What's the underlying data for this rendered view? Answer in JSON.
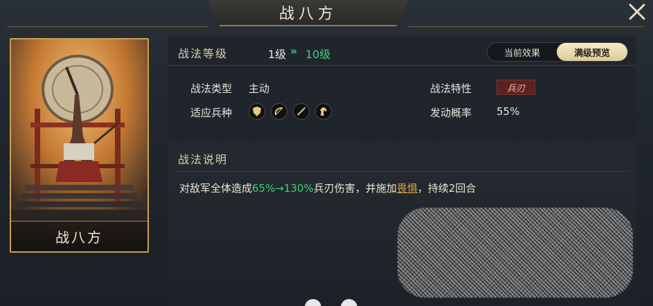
{
  "header": {
    "title": "战八方"
  },
  "card": {
    "name": "战八方"
  },
  "level": {
    "label": "战法等级",
    "current": "1级",
    "arrow": "»",
    "max": "10级"
  },
  "toggle": {
    "current_label": "当前效果",
    "max_label": "满级预览",
    "selected": "满级预览"
  },
  "info": {
    "type_label": "战法类型",
    "type_value": "主动",
    "trait_label": "战法特性",
    "trait_value": "兵刃",
    "units_label": "适应兵种",
    "units": [
      "shield-icon",
      "bow-icon",
      "spear-icon",
      "horse-icon"
    ],
    "chance_label": "发动概率",
    "chance_value": "55%"
  },
  "description": {
    "title": "战法说明",
    "prefix": "对敌军全体造成",
    "range": "65%→130%",
    "middle": "兵刃伤害，并施加",
    "status": "畏惧",
    "suffix": "，持续2回合"
  },
  "colors": {
    "accent_green": "#3fd07a",
    "gold": "#c9a24e",
    "trait_red": "#5a2320",
    "link_gold": "#d9a441"
  }
}
